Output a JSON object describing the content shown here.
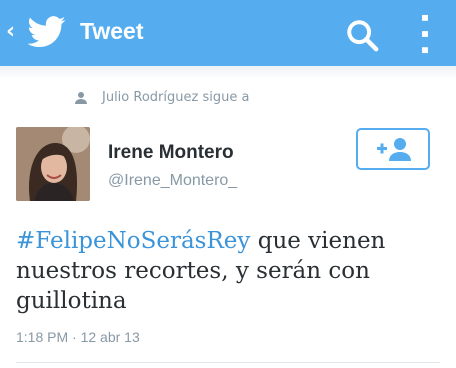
{
  "header": {
    "back_glyph": "‹",
    "title": "Tweet",
    "icons": [
      "twitter-bird-icon",
      "search-icon",
      "kebab-menu-icon"
    ]
  },
  "context": {
    "text": "Julio Rodríguez sigue a",
    "icon": "person-icon"
  },
  "tweet": {
    "author_name": "Irene Montero",
    "author_handle": "@Irene_Montero_",
    "hashtag": "#FelipeNoSerásRey",
    "text_rest": " que vienen nuestros recortes, y serán con guillotina",
    "timestamp": "1:18 PM · 12 abr 13"
  },
  "follow_button": {
    "icon": "add-user-icon"
  },
  "colors": {
    "accent": "#55acee",
    "link": "#3b94d9",
    "text": "#292f33",
    "muted": "#8899a6"
  }
}
